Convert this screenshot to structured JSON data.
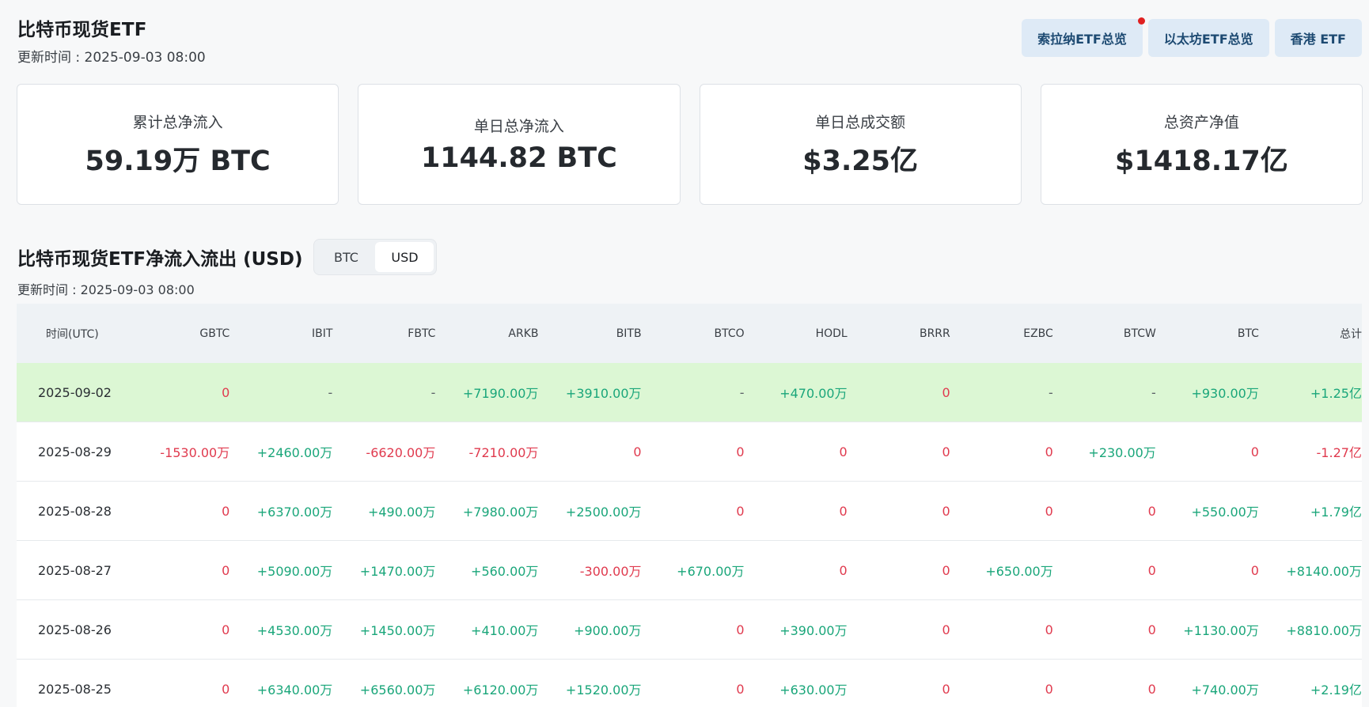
{
  "header": {
    "title": "比特币现货ETF",
    "update_time": "更新时间 : 2025-09-03 08:00"
  },
  "nav": [
    {
      "label": "索拉纳ETF总览",
      "dot": true
    },
    {
      "label": "以太坊ETF总览",
      "dot": false
    },
    {
      "label": "香港 ETF",
      "dot": false
    }
  ],
  "stats": [
    {
      "label": "累计总净流入",
      "value": "59.19万 BTC"
    },
    {
      "label": "单日总净流入",
      "value": "1144.82 BTC"
    },
    {
      "label": "单日总成交额",
      "value": "$3.25亿"
    },
    {
      "label": "总资产净值",
      "value": "$1418.17亿"
    }
  ],
  "section": {
    "title": "比特币现货ETF净流入流出 (USD)",
    "toggle": [
      "BTC",
      "USD"
    ],
    "toggle_active": "USD",
    "update_time": "更新时间 : 2025-09-03 08:00"
  },
  "colors": {
    "positive": "#1aa67a",
    "negative": "#e03a4e",
    "highlight_row": "#dcf7d4"
  },
  "table": {
    "columns": [
      "时间(UTC)",
      "GBTC",
      "IBIT",
      "FBTC",
      "ARKB",
      "BITB",
      "BTCO",
      "HODL",
      "BRRR",
      "EZBC",
      "BTCW",
      "BTC",
      "总计"
    ],
    "rows": [
      {
        "highlight": true,
        "cells": [
          "2025-09-02",
          "0",
          "-",
          "-",
          "+7190.00万",
          "+3910.00万",
          "-",
          "+470.00万",
          "0",
          "-",
          "-",
          "+930.00万",
          "+1.25亿"
        ]
      },
      {
        "highlight": false,
        "cells": [
          "2025-08-29",
          "-1530.00万",
          "+2460.00万",
          "-6620.00万",
          "-7210.00万",
          "0",
          "0",
          "0",
          "0",
          "0",
          "+230.00万",
          "0",
          "-1.27亿"
        ]
      },
      {
        "highlight": false,
        "cells": [
          "2025-08-28",
          "0",
          "+6370.00万",
          "+490.00万",
          "+7980.00万",
          "+2500.00万",
          "0",
          "0",
          "0",
          "0",
          "0",
          "+550.00万",
          "+1.79亿"
        ]
      },
      {
        "highlight": false,
        "cells": [
          "2025-08-27",
          "0",
          "+5090.00万",
          "+1470.00万",
          "+560.00万",
          "-300.00万",
          "+670.00万",
          "0",
          "0",
          "+650.00万",
          "0",
          "0",
          "+8140.00万"
        ]
      },
      {
        "highlight": false,
        "cells": [
          "2025-08-26",
          "0",
          "+4530.00万",
          "+1450.00万",
          "+410.00万",
          "+900.00万",
          "0",
          "+390.00万",
          "0",
          "0",
          "0",
          "+1130.00万",
          "+8810.00万"
        ]
      },
      {
        "highlight": false,
        "cells": [
          "2025-08-25",
          "0",
          "+6340.00万",
          "+6560.00万",
          "+6120.00万",
          "+1520.00万",
          "0",
          "+630.00万",
          "0",
          "0",
          "0",
          "+740.00万",
          "+2.19亿"
        ]
      }
    ]
  }
}
